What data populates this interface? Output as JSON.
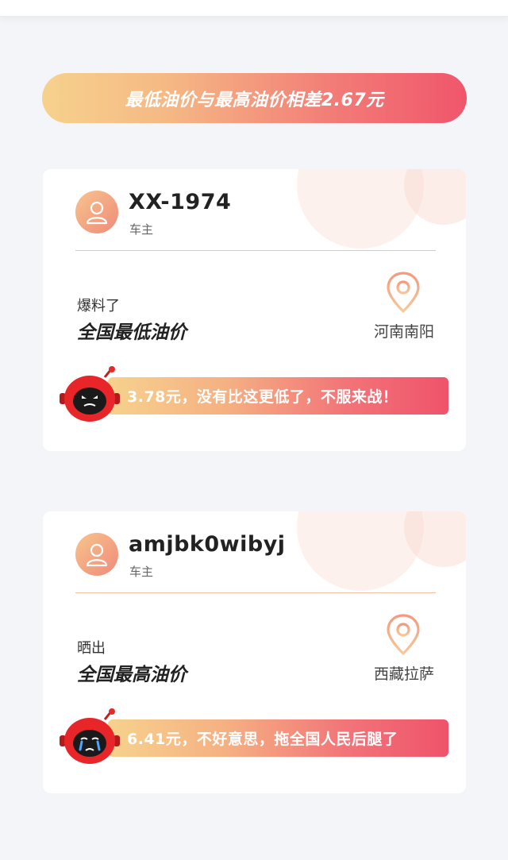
{
  "banner": {
    "text": "最低油价与最高油价相差2.67元"
  },
  "cards": [
    {
      "username": "XX-1974",
      "role": "车主",
      "action": "爆料了",
      "headline": "全国最低油价",
      "location": "河南南阳",
      "quote": "3.78元，没有比这更低了，不服来战！",
      "mascot_icon": "smug-robot-icon"
    },
    {
      "username": "amjbk0wibyj",
      "role": "车主",
      "action": "晒出",
      "headline": "全国最高油价",
      "location": "西藏拉萨",
      "quote": "6.41元，不好意思，拖全国人民后腿了",
      "mascot_icon": "crying-robot-icon"
    }
  ],
  "colors": {
    "accent_gradient_start": "#f6d28d",
    "accent_gradient_end": "#f0566b",
    "background": "#f4f5f9"
  }
}
